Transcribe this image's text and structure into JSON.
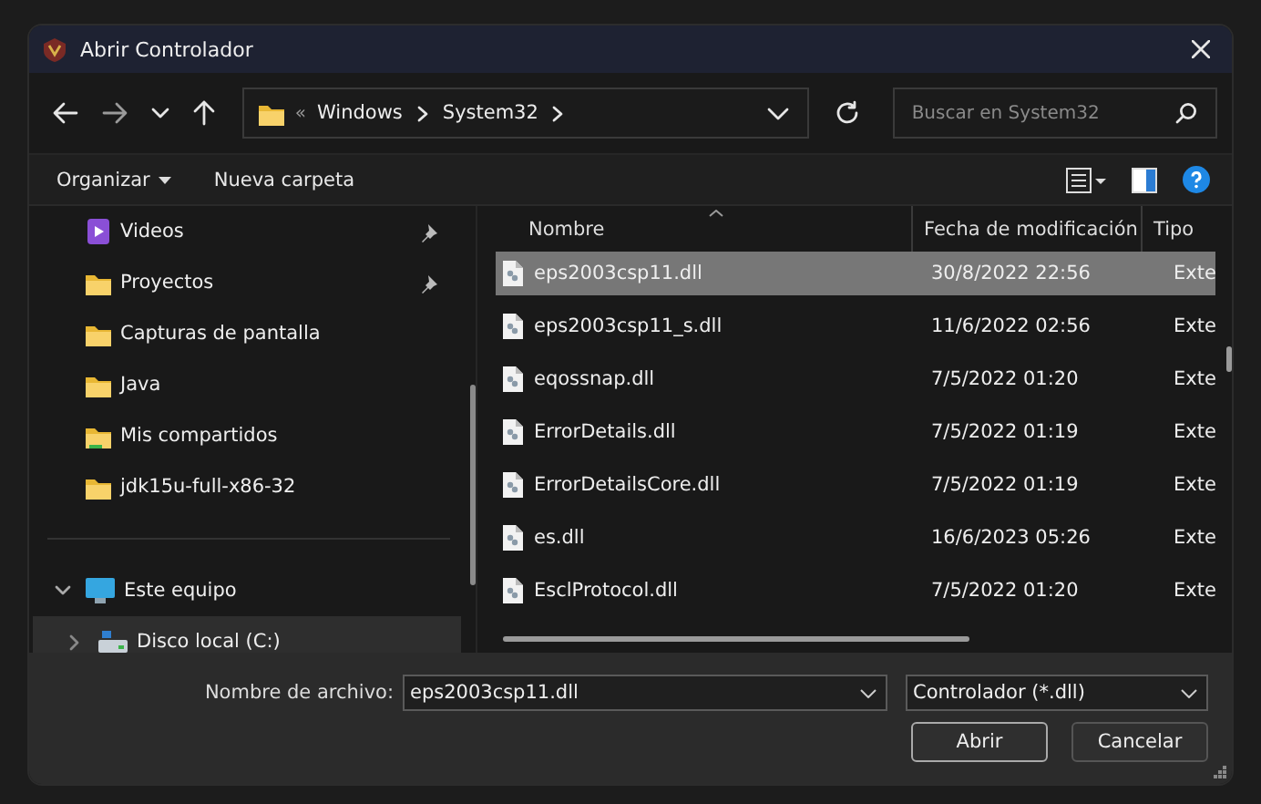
{
  "window": {
    "title": "Abrir Controlador"
  },
  "address": {
    "overflow": "«",
    "path": [
      "Windows",
      "System32"
    ]
  },
  "search": {
    "placeholder": "Buscar en System32"
  },
  "toolbar": {
    "organize": "Organizar",
    "new_folder": "Nueva carpeta"
  },
  "sidebar": {
    "quick_access": [
      {
        "label": "Videos",
        "kind": "video",
        "pinned": true
      },
      {
        "label": "Proyectos",
        "kind": "folder",
        "pinned": true
      },
      {
        "label": "Capturas de pantalla",
        "kind": "folder",
        "pinned": false
      },
      {
        "label": "Java",
        "kind": "folder",
        "pinned": false
      },
      {
        "label": "Mis compartidos",
        "kind": "shared",
        "pinned": false
      },
      {
        "label": "jdk15u-full-x86-32",
        "kind": "folder",
        "pinned": false
      }
    ],
    "tree": [
      {
        "label": "Este equipo",
        "kind": "computer",
        "expanded": true,
        "selected": false,
        "children": [
          {
            "label": "Disco local (C:)",
            "kind": "drive",
            "expanded": false,
            "selected": true
          }
        ]
      }
    ]
  },
  "table": {
    "columns": [
      "Nombre",
      "Fecha de modificación",
      "Tipo"
    ],
    "rows": [
      {
        "name": "eps2003csp11.dll",
        "date": "30/8/2022 22:56",
        "type": "Exte",
        "selected": true
      },
      {
        "name": "eps2003csp11_s.dll",
        "date": "11/6/2022 02:56",
        "type": "Exte",
        "selected": false
      },
      {
        "name": "eqossnap.dll",
        "date": "7/5/2022 01:20",
        "type": "Exte",
        "selected": false
      },
      {
        "name": "ErrorDetails.dll",
        "date": "7/5/2022 01:19",
        "type": "Exte",
        "selected": false
      },
      {
        "name": "ErrorDetailsCore.dll",
        "date": "7/5/2022 01:19",
        "type": "Exte",
        "selected": false
      },
      {
        "name": "es.dll",
        "date": "16/6/2023 05:26",
        "type": "Exte",
        "selected": false
      },
      {
        "name": "EsclProtocol.dll",
        "date": "7/5/2022 01:20",
        "type": "Exte",
        "selected": false
      }
    ]
  },
  "footer": {
    "filename_label": "Nombre de archivo:",
    "filename": "eps2003csp11.dll",
    "filter": "Controlador (*.dll)",
    "buttons": [
      "Abrir",
      "Cancelar"
    ]
  }
}
